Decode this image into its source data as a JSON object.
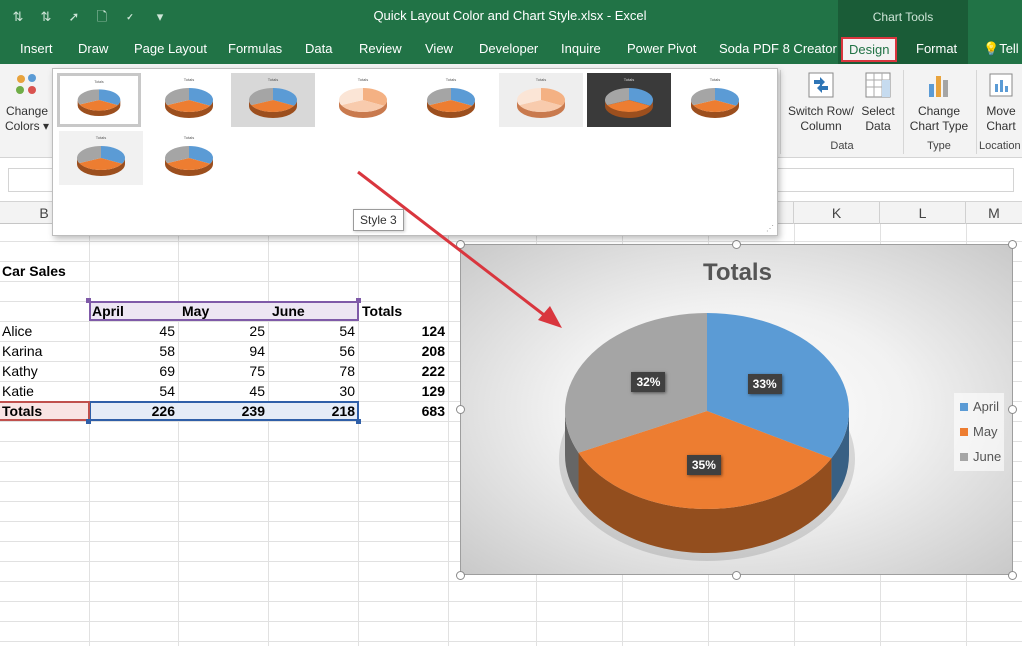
{
  "window": {
    "title": "Quick Layout Color and Chart Style.xlsx  -  Excel",
    "context_label": "Chart Tools"
  },
  "tabs": [
    "Insert",
    "Draw",
    "Page Layout",
    "Formulas",
    "Data",
    "Review",
    "View",
    "Developer",
    "Inquire",
    "Power Pivot",
    "Soda PDF 8 Creator",
    "Design",
    "Format",
    "Tell"
  ],
  "ribbon": {
    "change_colors_1": "Change",
    "change_colors_2": "Colors",
    "switch_row_1": "Switch Row/",
    "switch_row_2": "Column",
    "select_data_1": "Select",
    "select_data_2": "Data",
    "group_data": "Data",
    "change_type_1": "Change",
    "change_type_2": "Chart Type",
    "group_type": "Type",
    "move_chart_1": "Move",
    "move_chart_2": "Chart",
    "group_location": "Location"
  },
  "gallery": {
    "tooltip": "Style 3",
    "thumbnail_titles": [
      "Totals",
      "Totals",
      "Totals",
      "Totals",
      "Totals",
      "Totals",
      "Totals",
      "Totals",
      "Totals",
      "Totals"
    ]
  },
  "columns": [
    "B",
    "K",
    "L",
    "M"
  ],
  "sheet": {
    "title": "Car Sales",
    "headers": [
      "April",
      "May",
      "June",
      "Totals"
    ],
    "rows": [
      {
        "name": "Alice",
        "april": "45",
        "may": "25",
        "june": "54",
        "total": "124"
      },
      {
        "name": "Karina",
        "april": "58",
        "may": "94",
        "june": "56",
        "total": "208"
      },
      {
        "name": "Kathy",
        "april": "69",
        "may": "75",
        "june": "78",
        "total": "222"
      },
      {
        "name": "Katie",
        "april": "54",
        "may": "45",
        "june": "30",
        "total": "129"
      }
    ],
    "totals": {
      "name": "Totals",
      "april": "226",
      "may": "239",
      "june": "218",
      "total": "683"
    }
  },
  "chart_data": {
    "type": "pie",
    "title": "Totals",
    "categories": [
      "April",
      "May",
      "June"
    ],
    "values": [
      33,
      35,
      32
    ],
    "labels": [
      "33%",
      "35%",
      "32%"
    ],
    "colors": [
      "#5b9bd5",
      "#ed7d31",
      "#a5a5a5"
    ],
    "legend": "right",
    "style": "3d"
  },
  "colors": {
    "excel_green": "#217346",
    "design_tab_outline": "#d9363e",
    "arrow": "#d9363e"
  }
}
